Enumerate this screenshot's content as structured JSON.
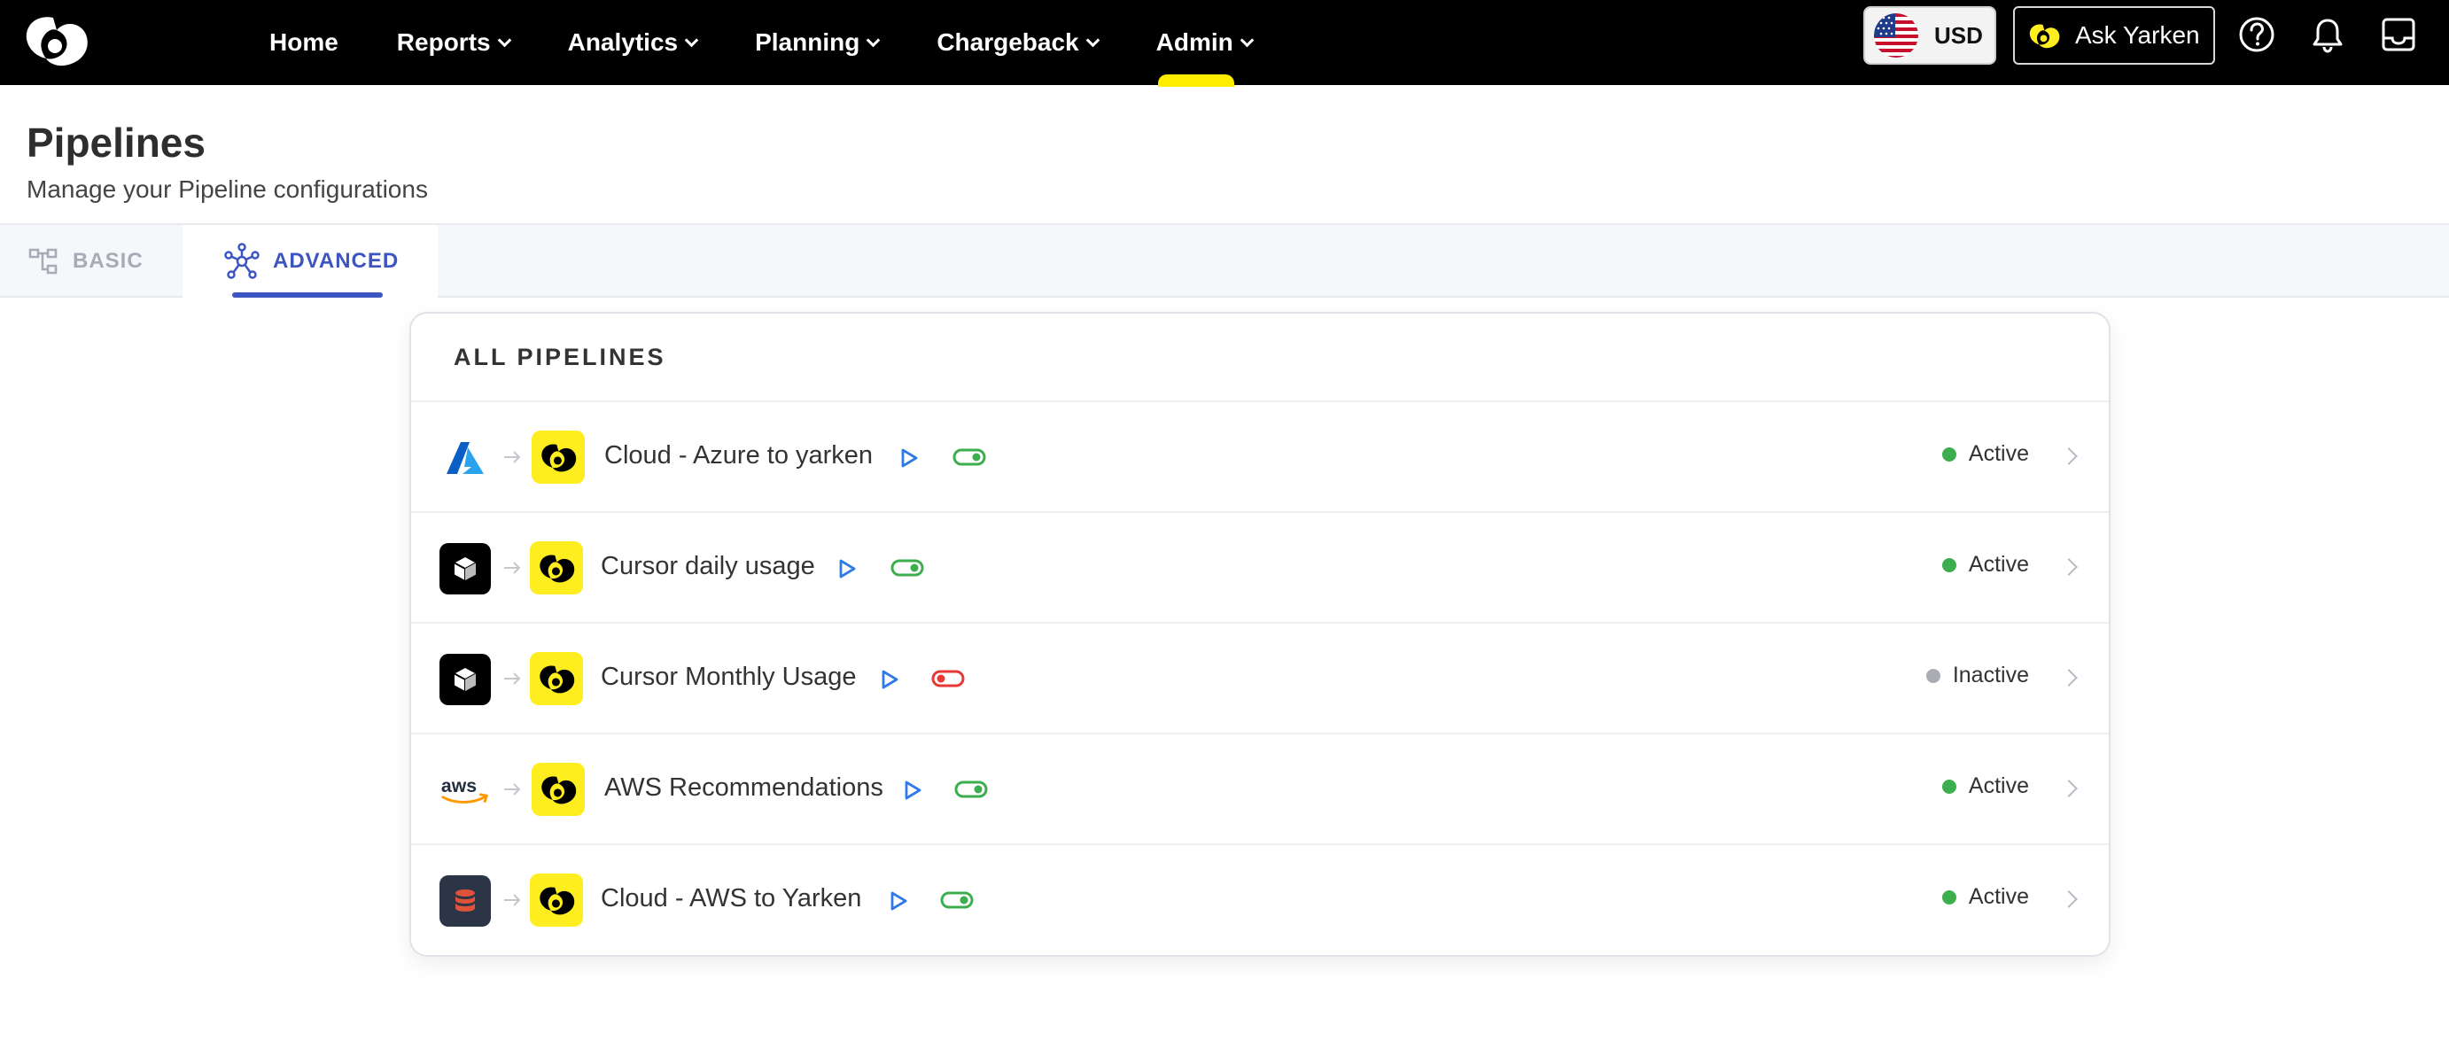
{
  "topbar": {
    "nav": [
      {
        "label": "Home",
        "has_menu": false
      },
      {
        "label": "Reports",
        "has_menu": true
      },
      {
        "label": "Analytics",
        "has_menu": true
      },
      {
        "label": "Planning",
        "has_menu": true
      },
      {
        "label": "Chargeback",
        "has_menu": true
      },
      {
        "label": "Admin",
        "has_menu": true,
        "active": true
      }
    ],
    "currency_label": "USD",
    "ask_label": "Ask Yarken",
    "icons": [
      "help-circle-icon",
      "bell-icon",
      "inbox-icon"
    ]
  },
  "header": {
    "title": "Pipelines",
    "subtitle": "Manage your Pipeline configurations"
  },
  "tabs": {
    "basic": "BASIC",
    "advanced": "ADVANCED",
    "selected": "advanced"
  },
  "pipelines": {
    "heading": "ALL PIPELINES",
    "rows": [
      {
        "name": "Cloud - Azure to yarken",
        "source_icon": "azure-icon",
        "destination_icon": "yarken-logo-icon",
        "enabled": true,
        "status": "Active"
      },
      {
        "name": "Cursor daily usage",
        "source_icon": "cursor-icon",
        "destination_icon": "yarken-logo-icon",
        "enabled": true,
        "status": "Active"
      },
      {
        "name": "Cursor Monthly Usage",
        "source_icon": "cursor-icon",
        "destination_icon": "yarken-logo-icon",
        "enabled": false,
        "status": "Inactive"
      },
      {
        "name": "AWS Recommendations",
        "source_icon": "aws-icon",
        "destination_icon": "yarken-logo-icon",
        "enabled": true,
        "status": "Active"
      },
      {
        "name": "Cloud - AWS to Yarken",
        "source_icon": "database-icon",
        "destination_icon": "yarken-logo-icon",
        "enabled": true,
        "status": "Active"
      }
    ]
  },
  "colors": {
    "accent": "#3d55c0",
    "brand_yellow": "#ffee1f",
    "active_green": "#3cae4e",
    "inactive_gray": "#a9adb3",
    "toggle_off_red": "#e53935",
    "play_blue": "#2f7ae5"
  }
}
